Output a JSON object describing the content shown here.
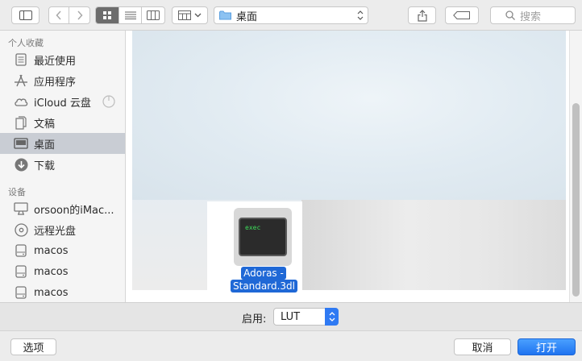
{
  "toolbar": {
    "path_label": "桌面",
    "search_placeholder": "搜索"
  },
  "sidebar": {
    "favorites_title": "个人收藏",
    "favorites": [
      {
        "label": "最近使用",
        "icon": "recents-icon"
      },
      {
        "label": "应用程序",
        "icon": "applications-icon"
      },
      {
        "label": "iCloud 云盘",
        "icon": "icloud-icon"
      },
      {
        "label": "文稿",
        "icon": "documents-icon"
      },
      {
        "label": "桌面",
        "icon": "desktop-icon"
      },
      {
        "label": "下载",
        "icon": "downloads-icon"
      }
    ],
    "devices_title": "设备",
    "devices": [
      {
        "label": "orsoon的iMac...",
        "icon": "imac-icon"
      },
      {
        "label": "远程光盘",
        "icon": "remote-disc-icon"
      },
      {
        "label": "macos",
        "icon": "disk-icon"
      },
      {
        "label": "macos",
        "icon": "disk-icon"
      },
      {
        "label": "macos",
        "icon": "disk-icon"
      }
    ]
  },
  "file": {
    "icon_text": "exec",
    "name_line1": "Adoras -",
    "name_line2": "Standard.3dl"
  },
  "enable": {
    "label": "启用:",
    "value": "LUT"
  },
  "footer": {
    "options_label": "选项",
    "cancel_label": "取消",
    "open_label": "打开"
  },
  "colors": {
    "accent": "#1f68d6",
    "selection": "#c9cdd4"
  }
}
